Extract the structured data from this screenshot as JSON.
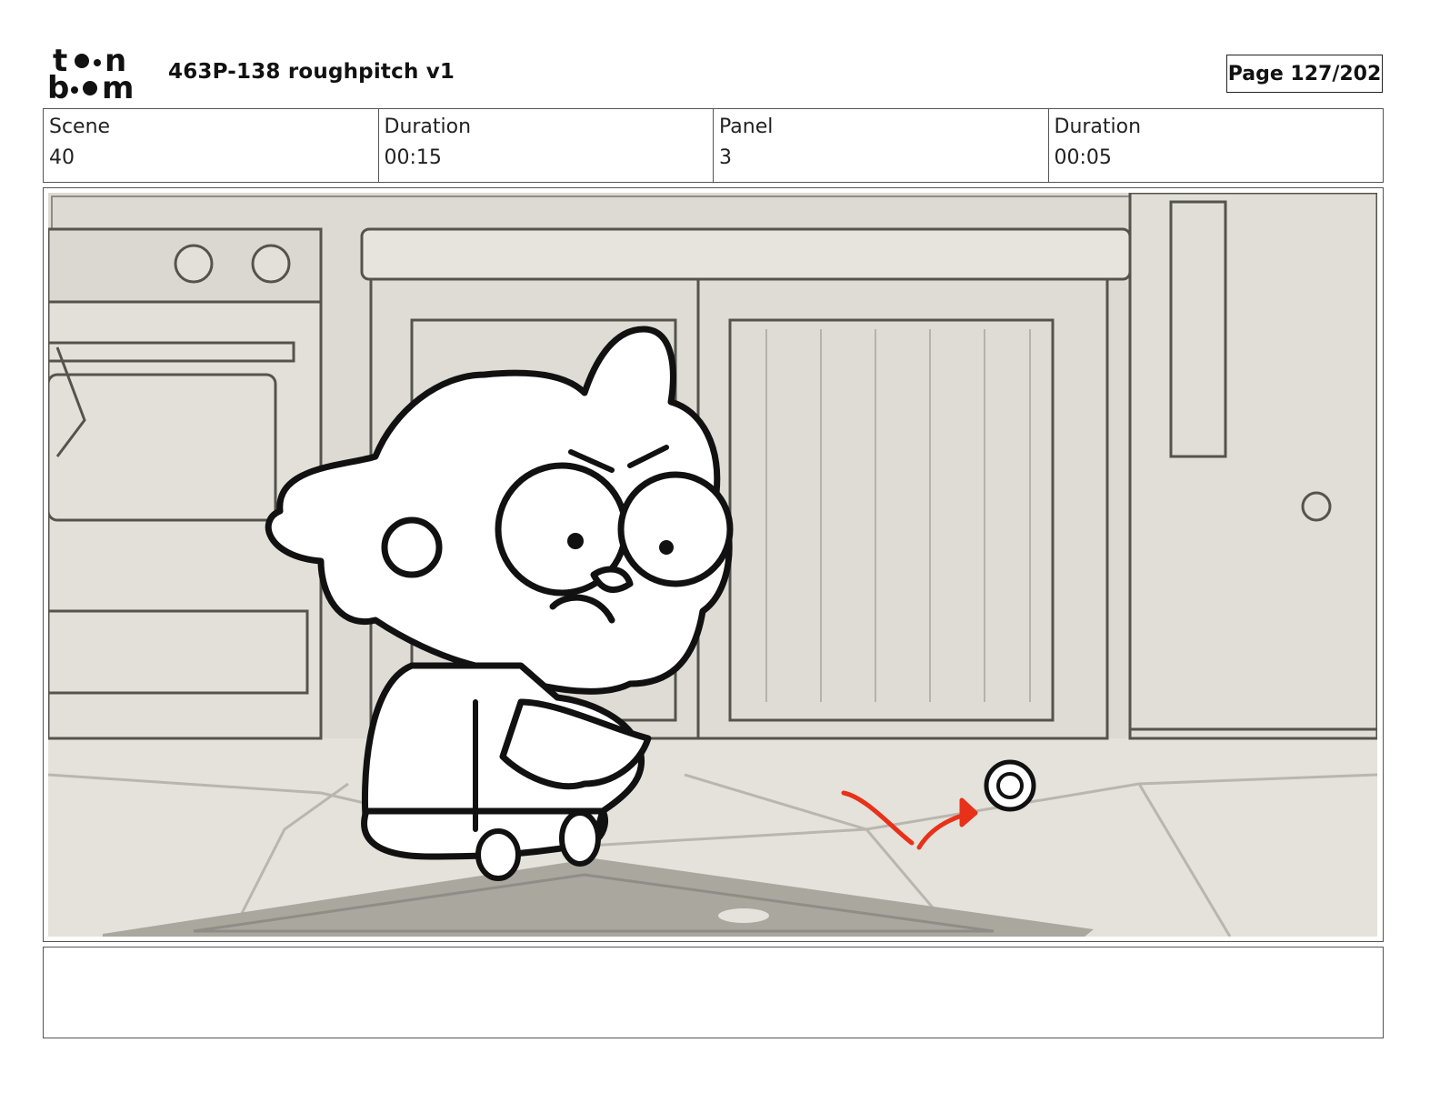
{
  "header": {
    "logo_text": [
      "to",
      "n",
      "b",
      "m"
    ],
    "doc_title": "463P-138 roughpitch v1",
    "page_label": "Page 127/202"
  },
  "info": [
    {
      "label": "Scene",
      "value": "40"
    },
    {
      "label": "Duration",
      "value": "00:15"
    },
    {
      "label": "Panel",
      "value": "3"
    },
    {
      "label": "Duration",
      "value": "00:05"
    }
  ],
  "panel": {
    "description": "",
    "notes": ""
  },
  "colors": {
    "background_art": "#dcdad2",
    "line_art": "#111111",
    "annotation_arrow": "#e8311a"
  }
}
